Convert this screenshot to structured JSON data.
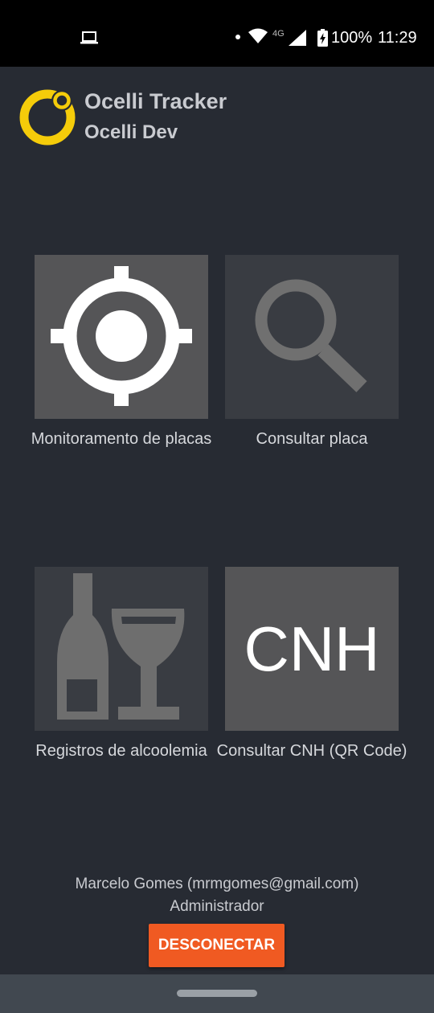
{
  "status_bar": {
    "network": "4G",
    "battery": "100%",
    "time": "11:29",
    "icons": [
      "cast-icon",
      "notification-dot",
      "wifi-icon",
      "signal-icon",
      "battery-charging-icon"
    ]
  },
  "header": {
    "title": "Ocelli Tracker",
    "subtitle": "Ocelli Dev",
    "logo_color": "#f5cc0a"
  },
  "tiles": [
    {
      "label": "Monitoramento de placas",
      "icon": "crosshair-icon"
    },
    {
      "label": "Consultar placa",
      "icon": "search-icon"
    },
    {
      "label": "Registros de alcoolemia",
      "icon": "bottle-glass-icon"
    },
    {
      "label": "Consultar CNH (QR Code)",
      "icon": "cnh-icon",
      "icon_text": "CNH"
    }
  ],
  "user": {
    "name_line": "Marcelo Gomes (mrmgomes@gmail.com)",
    "role": "Administrador"
  },
  "actions": {
    "disconnect_label": "DESCONECTAR",
    "disconnect_color": "#f05a22"
  }
}
